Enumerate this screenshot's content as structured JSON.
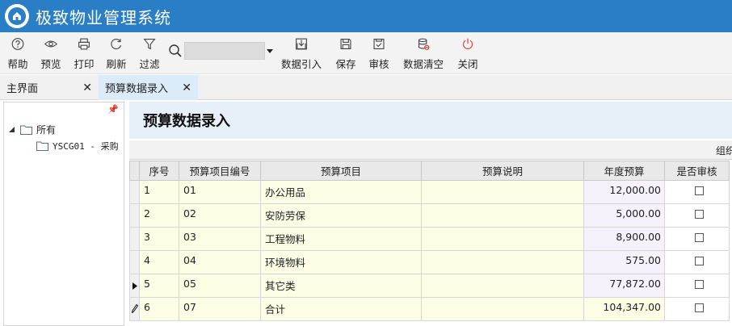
{
  "app": {
    "title": "极致物业管理系统"
  },
  "toolbar": {
    "buttons": [
      {
        "label": "帮助",
        "icon": "help-icon"
      },
      {
        "label": "预览",
        "icon": "eye-icon"
      },
      {
        "label": "打印",
        "icon": "printer-icon"
      },
      {
        "label": "刷新",
        "icon": "refresh-icon"
      },
      {
        "label": "过滤",
        "icon": "filter-icon"
      },
      {
        "label": "数据引入",
        "icon": "import-icon"
      },
      {
        "label": "保存",
        "icon": "save-icon"
      },
      {
        "label": "审核",
        "icon": "audit-icon"
      },
      {
        "label": "数据清空",
        "icon": "database-clear-icon"
      },
      {
        "label": "关闭",
        "icon": "power-icon"
      }
    ],
    "search": {
      "value": "",
      "icon": "search-icon"
    }
  },
  "tabs": [
    {
      "label": "主界面",
      "active": false
    },
    {
      "label": "预算数据录入",
      "active": true
    }
  ],
  "tree": {
    "root": "所有",
    "child": "YSCG01 - 采购"
  },
  "page": {
    "title": "预算数据录入",
    "group_label": "组织"
  },
  "table": {
    "columns": [
      "序号",
      "预算项目编号",
      "预算项目",
      "预算说明",
      "年度预算",
      "是否审核"
    ],
    "rows": [
      {
        "seq": "1",
        "code": "01",
        "item": "办公用品",
        "note": "",
        "budget": "12,000.00",
        "marker": "",
        "checked": false
      },
      {
        "seq": "2",
        "code": "02",
        "item": "安防劳保",
        "note": "",
        "budget": "5,000.00",
        "marker": "",
        "checked": false
      },
      {
        "seq": "3",
        "code": "03",
        "item": "工程物料",
        "note": "",
        "budget": "8,900.00",
        "marker": "",
        "checked": false
      },
      {
        "seq": "4",
        "code": "04",
        "item": "环境物料",
        "note": "",
        "budget": "575.00",
        "marker": "",
        "checked": false
      },
      {
        "seq": "5",
        "code": "05",
        "item": "其它类",
        "note": "",
        "budget": "77,872.00",
        "marker": "current",
        "checked": false
      },
      {
        "seq": "6",
        "code": "07",
        "item": "合计",
        "note": "",
        "budget": "104,347.00",
        "marker": "editing",
        "checked": false
      }
    ]
  },
  "colors": {
    "titlebar": "#2a7ec6",
    "header_band": "#e7f0f8",
    "editable_cell": "#fdfde6",
    "alt_cell": "#f6f1fa"
  }
}
